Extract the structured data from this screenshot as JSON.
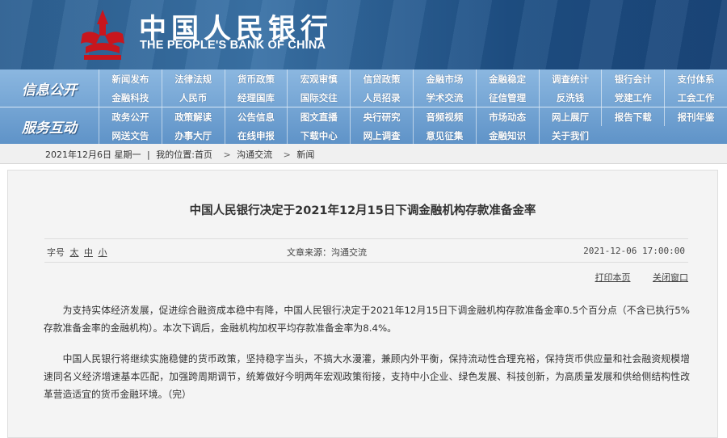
{
  "banner": {
    "name_cn": "中国人民银行",
    "name_en": "THE PEOPLE'S BANK OF CHINA",
    "logo_icon": "pboc-emblem-icon",
    "colors": {
      "banner": "#2c5f91",
      "emblem": "#c8161d"
    }
  },
  "nav": {
    "sections": [
      {
        "label": "信息公开",
        "rows": [
          [
            "新闻发布",
            "法律法规",
            "货币政策",
            "宏观审慎",
            "信贷政策",
            "金融市场",
            "金融稳定",
            "调查统计",
            "银行会计",
            "支付体系"
          ],
          [
            "金融科技",
            "人民币",
            "经理国库",
            "国际交往",
            "人员招录",
            "学术交流",
            "征信管理",
            "反洗钱",
            "党建工作",
            "工会工作"
          ]
        ]
      },
      {
        "label": "服务互动",
        "rows": [
          [
            "政务公开",
            "政策解读",
            "公告信息",
            "图文直播",
            "央行研究",
            "音频视频",
            "市场动态",
            "网上展厅",
            "报告下载",
            "报刊年鉴"
          ],
          [
            "网送文告",
            "办事大厅",
            "在线申报",
            "下载中心",
            "网上调查",
            "意见征集",
            "金融知识",
            "关于我们"
          ]
        ]
      }
    ]
  },
  "breadcrumb": {
    "date": "2021年12月6日 星期一",
    "separator": "|",
    "location_label": "我的位置:",
    "items": [
      "首页",
      "沟通交流",
      "新闻"
    ],
    "arrow": ">"
  },
  "article": {
    "title": "中国人民银行决定于2021年12月15日下调金融机构存款准备金率",
    "font_size_label": "字号",
    "font_sizes": [
      "太",
      "中",
      "小"
    ],
    "source": "文章来源：沟通交流",
    "datetime": "2021-12-06 17:00:00",
    "print_label": "打印本页",
    "close_label": "关闭窗口",
    "paragraphs": [
      "为支持实体经济发展，促进综合融资成本稳中有降，中国人民银行决定于2021年12月15日下调金融机构存款准备金率0.5个百分点（不含已执行5%存款准备金率的金融机构）。本次下调后，金融机构加权平均存款准备金率为8.4%。",
      "中国人民银行将继续实施稳健的货币政策，坚持稳字当头，不搞大水漫灌，兼顾内外平衡，保持流动性合理充裕，保持货币供应量和社会融资规模增速同名义经济增速基本匹配，加强跨周期调节，统筹做好今明两年宏观政策衔接，支持中小企业、绿色发展、科技创新，为高质量发展和供给侧结构性改革营造适宜的货币金融环境。（完）"
    ]
  }
}
